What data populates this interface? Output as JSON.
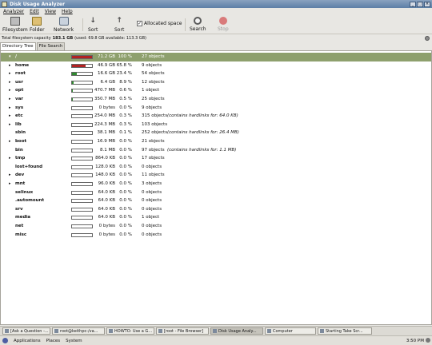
{
  "window": {
    "title": "Disk Usage Analyzer"
  },
  "menu": [
    "Analyzer",
    "Edit",
    "View",
    "Help"
  ],
  "toolbar": {
    "filesystem": "Filesystem",
    "folder": "Folder",
    "network": "Network",
    "sort_a": "Sort",
    "sort_b": "Sort",
    "allocated": "Allocated space",
    "allocated_checked": true,
    "search": "Search",
    "stop": "Stop"
  },
  "status": {
    "prefix": "Total filesystem capacity",
    "capacity": "183.1 GB",
    "suffix": "(used: 69.8 GB available: 113.3 GB)"
  },
  "tabs": [
    "Directory Tree",
    "File Search"
  ],
  "rows": [
    {
      "name": "/",
      "size": "71.2 GB",
      "pct": "100 %",
      "objs": "27 objects",
      "fill": 1.0,
      "color": "#b22222",
      "note": "",
      "expander": "▾",
      "selected": true
    },
    {
      "name": "home",
      "size": "46.9 GB",
      "pct": "65.8 %",
      "objs": "9 objects",
      "fill": 0.66,
      "color": "#b22222",
      "note": "",
      "expander": "▸"
    },
    {
      "name": "root",
      "size": "16.6 GB",
      "pct": "23.4 %",
      "objs": "54 objects",
      "fill": 0.23,
      "color": "#2e8b2e",
      "note": "",
      "expander": "▸"
    },
    {
      "name": "usr",
      "size": "6.4 GB",
      "pct": "8.9 %",
      "objs": "12 objects",
      "fill": 0.09,
      "color": "#2e8b2e",
      "note": "",
      "expander": "▸"
    },
    {
      "name": "opt",
      "size": "470.7 MB",
      "pct": "0.6 %",
      "objs": "1 object",
      "fill": 0.01,
      "color": "#2e8b2e",
      "note": "",
      "expander": "▸"
    },
    {
      "name": "var",
      "size": "350.7 MB",
      "pct": "0.5 %",
      "objs": "25 objects",
      "fill": 0.005,
      "color": "#2e8b2e",
      "note": "",
      "expander": "▸"
    },
    {
      "name": "sys",
      "size": "0 bytes",
      "pct": "0.0 %",
      "objs": "9 objects",
      "fill": 0,
      "color": "#2e8b2e",
      "note": "",
      "expander": "▸"
    },
    {
      "name": "etc",
      "size": "254.0 MB",
      "pct": "0.3 %",
      "objs": "315 objects",
      "fill": 0.003,
      "color": "#2e8b2e",
      "note": "(contains hardlinks for: 64.0 KB)",
      "expander": "▸"
    },
    {
      "name": "lib",
      "size": "224.3 MB",
      "pct": "0.3 %",
      "objs": "103 objects",
      "fill": 0.003,
      "color": "#2e8b2e",
      "note": "",
      "expander": "▸"
    },
    {
      "name": "sbin",
      "size": "38.1 MB",
      "pct": "0.1 %",
      "objs": "252 objects",
      "fill": 0.001,
      "color": "#2e8b2e",
      "note": "(contains hardlinks for: 26.4 MB)",
      "expander": ""
    },
    {
      "name": "boot",
      "size": "16.9 MB",
      "pct": "0.0 %",
      "objs": "21 objects",
      "fill": 0,
      "color": "#2e8b2e",
      "note": "",
      "expander": "▸"
    },
    {
      "name": "bin",
      "size": "8.1 MB",
      "pct": "0.0 %",
      "objs": "97 objects",
      "fill": 0,
      "color": "#2e8b2e",
      "note": "(contains hardlinks for: 1.1 MB)",
      "expander": ""
    },
    {
      "name": "tmp",
      "size": "864.0 KB",
      "pct": "0.0 %",
      "objs": "17 objects",
      "fill": 0,
      "color": "#2e8b2e",
      "note": "",
      "expander": "▸"
    },
    {
      "name": "lost+found",
      "size": "128.0 KB",
      "pct": "0.0 %",
      "objs": "0 objects",
      "fill": 0,
      "color": "#2e8b2e",
      "note": "",
      "expander": ""
    },
    {
      "name": "dev",
      "size": "148.0 KB",
      "pct": "0.0 %",
      "objs": "11 objects",
      "fill": 0,
      "color": "#2e8b2e",
      "note": "",
      "expander": "▸"
    },
    {
      "name": "mnt",
      "size": "96.0 KB",
      "pct": "0.0 %",
      "objs": "3 objects",
      "fill": 0,
      "color": "#2e8b2e",
      "note": "",
      "expander": "▸"
    },
    {
      "name": "selinux",
      "size": "64.0 KB",
      "pct": "0.0 %",
      "objs": "0 objects",
      "fill": 0,
      "color": "#2e8b2e",
      "note": "",
      "expander": ""
    },
    {
      "name": ".automount",
      "size": "64.0 KB",
      "pct": "0.0 %",
      "objs": "0 objects",
      "fill": 0,
      "color": "#2e8b2e",
      "note": "",
      "expander": ""
    },
    {
      "name": "srv",
      "size": "64.0 KB",
      "pct": "0.0 %",
      "objs": "0 objects",
      "fill": 0,
      "color": "#2e8b2e",
      "note": "",
      "expander": ""
    },
    {
      "name": "media",
      "size": "64.0 KB",
      "pct": "0.0 %",
      "objs": "1 object",
      "fill": 0,
      "color": "#2e8b2e",
      "note": "",
      "expander": ""
    },
    {
      "name": "net",
      "size": "0 bytes",
      "pct": "0.0 %",
      "objs": "0 objects",
      "fill": 0,
      "color": "#2e8b2e",
      "note": "",
      "expander": ""
    },
    {
      "name": "misc",
      "size": "0 bytes",
      "pct": "0.0 %",
      "objs": "0 objects",
      "fill": 0,
      "color": "#2e8b2e",
      "note": "",
      "expander": ""
    }
  ],
  "taskbar": [
    {
      "label": "[Ask a Question -...",
      "active": false
    },
    {
      "label": "root@keithpc:/va...",
      "active": false
    },
    {
      "label": "HOWTO: Use a G...",
      "active": false
    },
    {
      "label": "[root - File Browser]",
      "active": false
    },
    {
      "label": "Disk Usage Analy...",
      "active": true
    },
    {
      "label": "Computer",
      "active": false
    },
    {
      "label": "Starting Take Scr...",
      "active": false
    }
  ],
  "panel": {
    "applications": "Applications",
    "places": "Places",
    "system": "System",
    "clock": "3:50 PM"
  }
}
